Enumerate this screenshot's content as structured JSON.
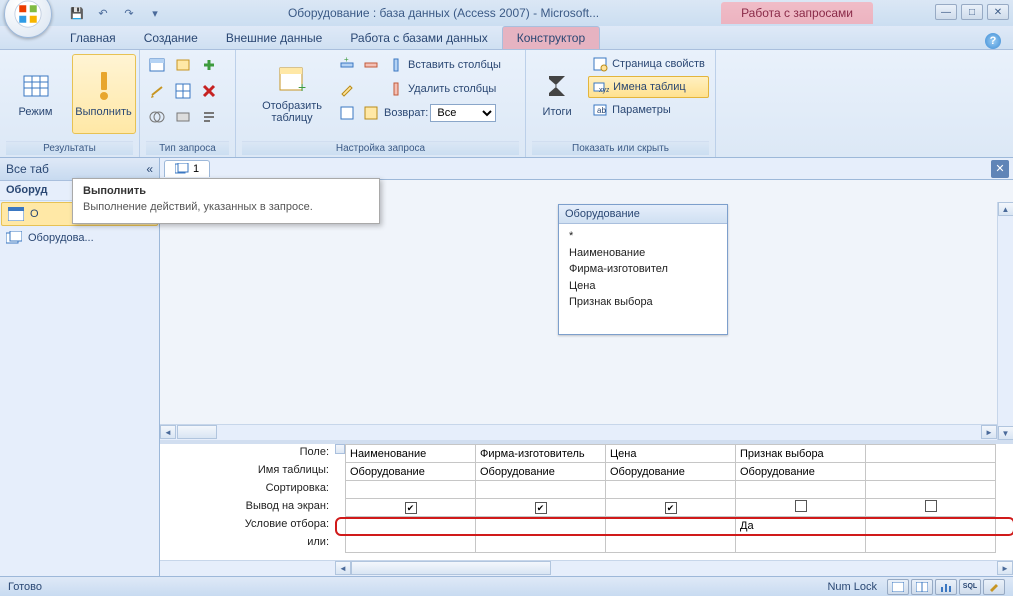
{
  "app": {
    "title": "Оборудование : база данных (Access 2007) - Microsoft...",
    "contextTabGroup": "Работа с запросами"
  },
  "tabs": {
    "home": "Главная",
    "create": "Создание",
    "external": "Внешние данные",
    "dbtools": "Работа с базами данных",
    "design": "Конструктор"
  },
  "ribbon": {
    "group_results": "Результаты",
    "mode": "Режим",
    "run": "Выполнить",
    "group_querytype": "Тип запроса",
    "group_querysetup": "Настройка запроса",
    "showtable": "Отобразить\nтаблицу",
    "insertcols": "Вставить столбцы",
    "deletecols": "Удалить столбцы",
    "return": "Возврат:",
    "return_value": "Все",
    "totals": "Итоги",
    "group_showhide": "Показать или скрыть",
    "propsheet": "Страница свойств",
    "tablenames": "Имена таблиц",
    "parameters": "Параметры"
  },
  "tooltip": {
    "title": "Выполнить",
    "body": "Выполнение действий, указанных в запросе."
  },
  "nav": {
    "header": "Все таб",
    "category": "Оборуд",
    "item1": "О",
    "item2": "Оборудова..."
  },
  "doc": {
    "tab": "1"
  },
  "tablebox": {
    "title": "Оборудование",
    "fields": [
      "*",
      "Наименование",
      "Фирма-изготовител",
      "Цена",
      "Признак выбора"
    ]
  },
  "gridRows": {
    "field": "Поле:",
    "table": "Имя таблицы:",
    "sort": "Сортировка:",
    "show": "Вывод на экран:",
    "criteria": "Условие отбора:",
    "or": "или:"
  },
  "gridCols": [
    {
      "field": "Наименование",
      "table": "Оборудование",
      "show": true,
      "criteria": ""
    },
    {
      "field": "Фирма-изготовитель",
      "table": "Оборудование",
      "show": true,
      "criteria": ""
    },
    {
      "field": "Цена",
      "table": "Оборудование",
      "show": true,
      "criteria": ""
    },
    {
      "field": "Признак выбора",
      "table": "Оборудование",
      "show": false,
      "criteria": "Да"
    },
    {
      "field": "",
      "table": "",
      "show": false,
      "criteria": ""
    }
  ],
  "status": {
    "ready": "Готово",
    "numlock": "Num Lock",
    "sql": "SQL"
  }
}
